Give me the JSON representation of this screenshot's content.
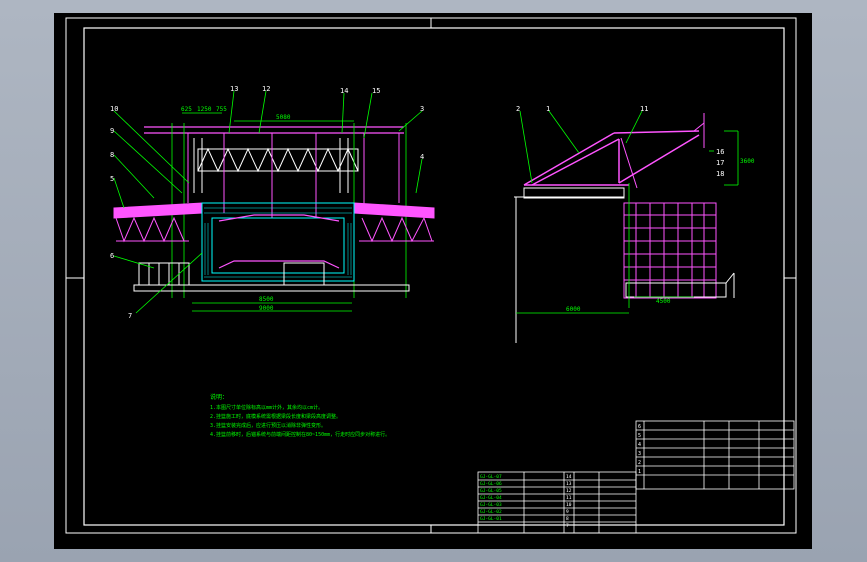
{
  "drawing": {
    "front_view": {
      "callouts": [
        "10",
        "9",
        "8",
        "5",
        "6",
        "7",
        "13",
        "12",
        "14",
        "15",
        "3",
        "4"
      ],
      "dims_top": [
        "625",
        "1250",
        "755"
      ],
      "dim_beam": "5080",
      "dim_bottom_1": "8500",
      "dim_bottom_2": "9000"
    },
    "side_view": {
      "callouts": [
        "2",
        "1",
        "11",
        "16",
        "17",
        "18"
      ],
      "dim_height": "3600",
      "dim_base": "6000",
      "dim_small": "4500"
    },
    "notes": {
      "header": "说明：",
      "lines": [
        "1.本图尺寸单位除标高以mm计外，其余均以cm计。",
        "2.挂篮施工时，底模系统需根据梁段长度和梁段高度调整。",
        "3.挂篮安装完成后，应进行预压以消除非弹性变形。",
        "4.挂篮前移时，后锚系统与前端间距控制在80~150mm，行走时应同步对称进行。"
      ]
    },
    "title_block": {
      "rows": [
        "14",
        "13",
        "12",
        "11",
        "10",
        "9",
        "8",
        "7",
        "6",
        "5"
      ],
      "codes": [
        "GJ-GL-07",
        "GJ-GL-06",
        "GJ-GL-05",
        "GJ-GL-04",
        "GJ-GL-03",
        "GJ-GL-02",
        "GJ-GL-01"
      ],
      "parts_rows": [
        "6",
        "5",
        "4",
        "3",
        "2",
        "1"
      ]
    }
  }
}
